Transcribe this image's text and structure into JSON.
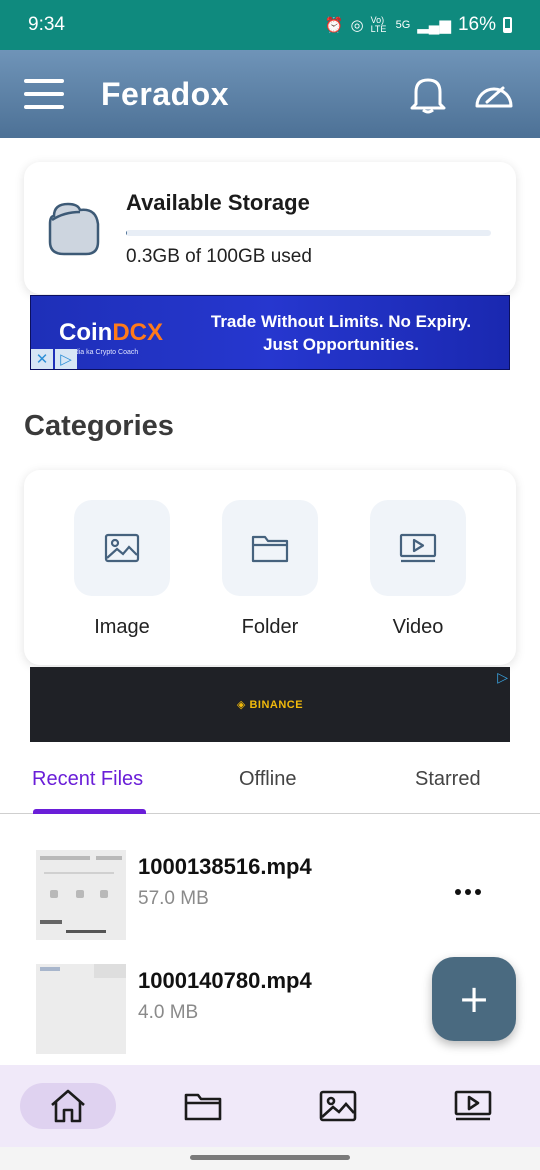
{
  "status_bar": {
    "time": "9:34",
    "network_label": "Vo) LTE",
    "signal_label": "5G",
    "battery": "16%"
  },
  "app_bar": {
    "title": "Feradox",
    "icons": [
      "menu-icon",
      "bell-icon",
      "speedometer-icon"
    ]
  },
  "storage": {
    "title": "Available Storage",
    "used_text": "0.3GB of 100GB used",
    "used_fraction": 0.003
  },
  "ad_top": {
    "brand_main": "Coin",
    "brand_accent": "DCX",
    "tagline": "India ka Crypto Coach",
    "headline_line1": "Trade Without Limits. No Expiry.",
    "headline_line2": "Just Opportunities.",
    "close_glyph": "✕",
    "adchoice_glyph": "▷"
  },
  "categories": {
    "title": "Categories",
    "items": [
      {
        "label": "Image",
        "icon": "image-icon"
      },
      {
        "label": "Folder",
        "icon": "folder-icon"
      },
      {
        "label": "Video",
        "icon": "video-icon"
      }
    ]
  },
  "ad_bottom": {
    "brand": "BINANCE",
    "adchoice_glyph": "▷"
  },
  "tabs": [
    {
      "label": "Recent Files",
      "active": true
    },
    {
      "label": "Offline",
      "active": false
    },
    {
      "label": "Starred",
      "active": false
    }
  ],
  "files": [
    {
      "name": "1000138516.mp4",
      "size": "57.0 MB"
    },
    {
      "name": "1000140780.mp4",
      "size": "4.0 MB"
    }
  ],
  "fab": {
    "glyph": "+"
  },
  "bottom_nav": [
    {
      "icon": "home-icon",
      "active": true
    },
    {
      "icon": "folder-icon",
      "active": false
    },
    {
      "icon": "image-icon",
      "active": false
    },
    {
      "icon": "video-icon",
      "active": false
    }
  ],
  "colors": {
    "status_bar": "#0f8a7e",
    "app_bar": "#5a7fa4",
    "accent": "#6a1ed8",
    "fab": "#4a6a80",
    "bottom_nav": "#f0e9f9"
  }
}
